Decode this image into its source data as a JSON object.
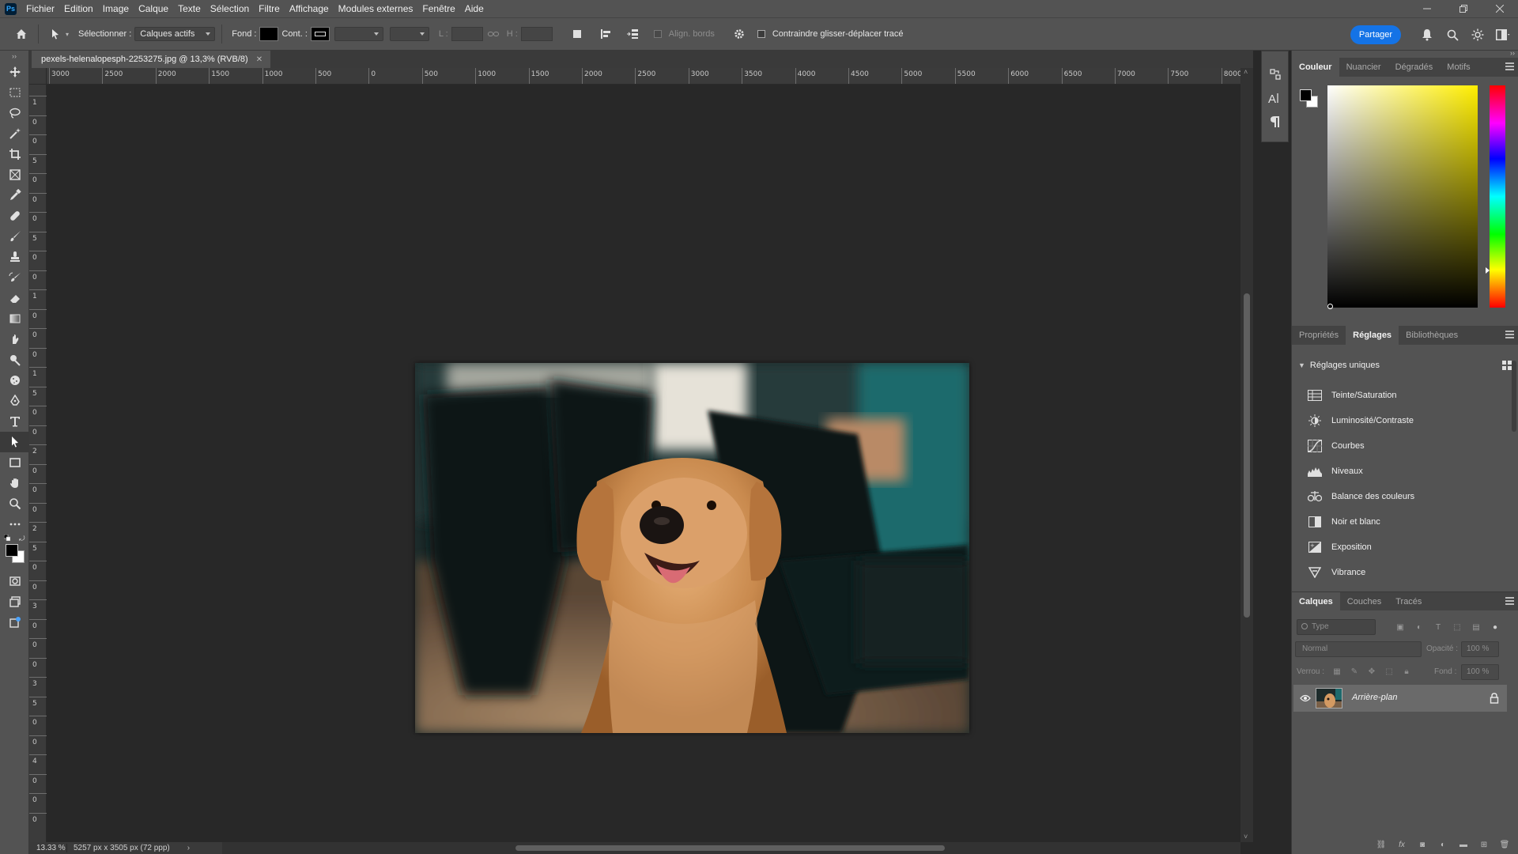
{
  "app": {
    "logo": "Ps"
  },
  "menu": [
    "Fichier",
    "Edition",
    "Image",
    "Calque",
    "Texte",
    "Sélection",
    "Filtre",
    "Affichage",
    "Modules externes",
    "Fenêtre",
    "Aide"
  ],
  "options": {
    "select_label": "Sélectionner :",
    "select_value": "Calques actifs",
    "fill_label": "Fond :",
    "stroke_label": "Cont. :",
    "w_label": "L :",
    "h_label": "H :",
    "align_edges_label": "Align. bords",
    "constrain_label": "Contraindre glisser-déplacer tracé",
    "share_label": "Partager"
  },
  "document": {
    "tab_title": "pexels-helenalopesph-2253275.jpg @ 13,3% (RVB/8)",
    "zoom": "13.33 %",
    "size_info": "5257 px x 3505 px (72 ppp)"
  },
  "ruler_h": [
    "3000",
    "2500",
    "2000",
    "1500",
    "1000",
    "500",
    "0",
    "500",
    "1000",
    "1500",
    "2000",
    "2500",
    "3000",
    "3500",
    "4000",
    "4500",
    "5000",
    "5500",
    "6000",
    "6500",
    "7000",
    "7500",
    "8000"
  ],
  "ruler_v": [
    "1",
    "0",
    "0",
    "5",
    "0",
    "0",
    "0",
    "5",
    "0",
    "0",
    "1",
    "0",
    "0",
    "0",
    "1",
    "5",
    "0",
    "0",
    "2",
    "0",
    "0",
    "0",
    "2",
    "5",
    "0",
    "0",
    "3",
    "0",
    "0",
    "0",
    "3",
    "5",
    "0",
    "0",
    "4",
    "0",
    "0",
    "0"
  ],
  "color_panel": {
    "tabs": [
      "Couleur",
      "Nuancier",
      "Dégradés",
      "Motifs"
    ],
    "active_tab": "Couleur",
    "foreground": "#000000",
    "background": "#ffffff",
    "hue_color": "#ffee00"
  },
  "adjust_panel": {
    "tabs": [
      "Propriétés",
      "Réglages",
      "Bibliothèques"
    ],
    "active_tab": "Réglages",
    "section_title": "Réglages uniques",
    "items": [
      {
        "label": "Teinte/Saturation",
        "icon": "hue-saturation-icon"
      },
      {
        "label": "Luminosité/Contraste",
        "icon": "brightness-icon"
      },
      {
        "label": "Courbes",
        "icon": "curves-icon"
      },
      {
        "label": "Niveaux",
        "icon": "levels-icon"
      },
      {
        "label": "Balance des couleurs",
        "icon": "color-balance-icon"
      },
      {
        "label": "Noir et blanc",
        "icon": "black-white-icon"
      },
      {
        "label": "Exposition",
        "icon": "exposure-icon"
      },
      {
        "label": "Vibrance",
        "icon": "vibrance-icon"
      }
    ]
  },
  "layers_panel": {
    "tabs": [
      "Calques",
      "Couches",
      "Tracés"
    ],
    "active_tab": "Calques",
    "filter_placeholder": "Type",
    "blend_mode": "Normal",
    "opacity_label": "Opacité :",
    "opacity_value": "100 %",
    "lock_label": "Verrou :",
    "fill_label": "Fond :",
    "fill_value": "100 %",
    "layers": [
      {
        "name": "Arrière-plan",
        "visible": true,
        "locked": true
      }
    ]
  }
}
